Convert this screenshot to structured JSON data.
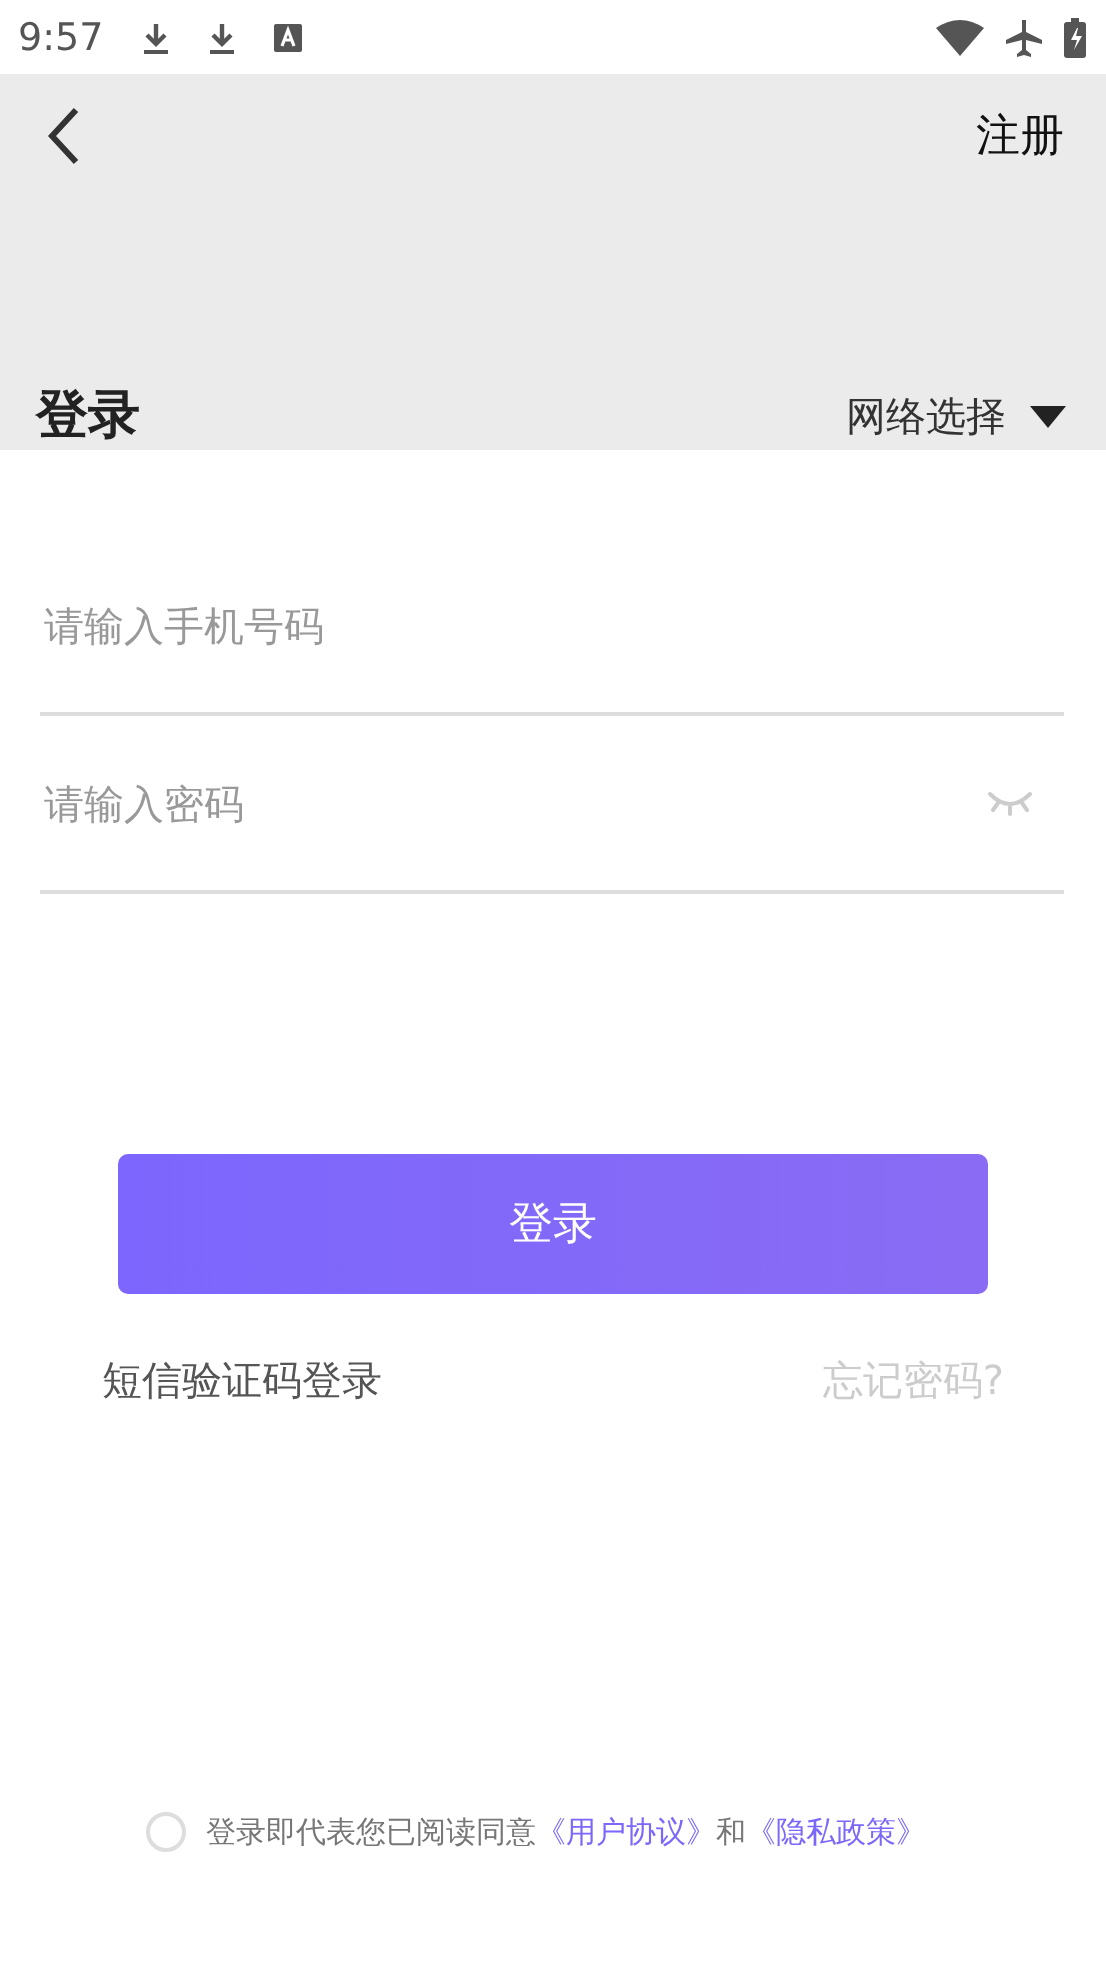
{
  "status_bar": {
    "time": "9:57"
  },
  "header": {
    "action": "注册",
    "title": "登录",
    "network_select": "网络选择"
  },
  "fields": [
    {
      "kind": "text",
      "placeholder": "请输入手机号码"
    },
    {
      "kind": "password",
      "placeholder": "请输入密码"
    }
  ],
  "login_button": "登录",
  "links": {
    "sms_login": "短信验证码登录",
    "forgot_password": "忘记密码?"
  },
  "agreement": {
    "checked": false,
    "text": "登录即代表您已阅读同意",
    "link_1": "《用户协议》",
    "joiner": "和",
    "link_2": "《隐私政策》"
  }
}
